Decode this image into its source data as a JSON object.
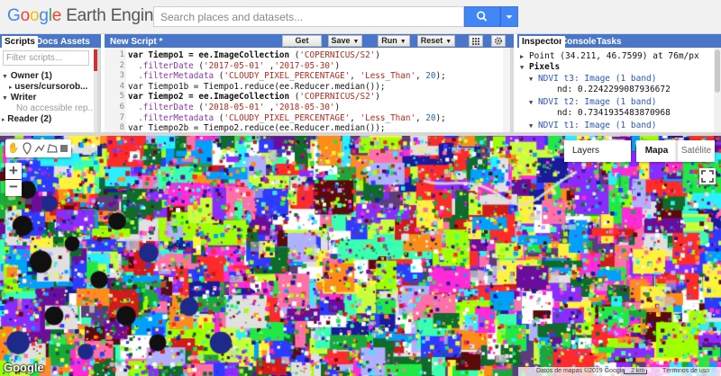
{
  "app": {
    "logo_google": "Google",
    "logo_rest": " Earth Engine"
  },
  "search": {
    "placeholder": "Search places and datasets..."
  },
  "left_tabs": [
    "Scripts",
    "Docs",
    "Assets"
  ],
  "scripts": {
    "filter_placeholder": "Filter scripts...",
    "tree": [
      {
        "label": "Owner",
        "count": "(1)"
      },
      {
        "label": "users/cursorob..."
      },
      {
        "label": "Writer"
      },
      {
        "label": "No accessible rep..."
      },
      {
        "label": "Reader",
        "count": "(2)"
      }
    ]
  },
  "editor": {
    "tab_title": "New Script *",
    "buttons": {
      "get_link": "Get Link",
      "save": "Save",
      "run": "Run",
      "reset": "Reset"
    },
    "line_numbers": [
      "1",
      "2",
      "3",
      "4",
      "5",
      "6",
      "7",
      "8"
    ],
    "lines": [
      [
        {
          "t": "var Tiempo1 = ",
          "c": "k"
        },
        {
          "t": "ee.ImageCollection",
          "c": "k"
        },
        {
          "t": " (",
          "c": ""
        },
        {
          "t": "'COPERNICUS/S2'",
          "c": "s"
        },
        {
          "t": ")",
          "c": ""
        }
      ],
      [
        {
          "t": "  .filterDate",
          "c": "m"
        },
        {
          "t": " (",
          "c": ""
        },
        {
          "t": "'2017-05-01'",
          "c": "s"
        },
        {
          "t": " ,",
          "c": ""
        },
        {
          "t": "'2017-05-30'",
          "c": "s"
        },
        {
          "t": ")",
          "c": ""
        }
      ],
      [
        {
          "t": "  .filterMetadata",
          "c": "m"
        },
        {
          "t": " (",
          "c": ""
        },
        {
          "t": "'CLOUDY_PIXEL_PERCENTAGE'",
          "c": "s"
        },
        {
          "t": ", ",
          "c": ""
        },
        {
          "t": "'Less_Than'",
          "c": "s"
        },
        {
          "t": ", ",
          "c": ""
        },
        {
          "t": "20",
          "c": "n"
        },
        {
          "t": ");",
          "c": ""
        }
      ],
      [
        {
          "t": "var Tiempo1b = Tiempo1.reduce(ee.Reducer.median());",
          "c": ""
        }
      ],
      [
        {
          "t": "var Tiempo2 = ",
          "c": "k"
        },
        {
          "t": "ee.ImageCollection",
          "c": "k"
        },
        {
          "t": " (",
          "c": ""
        },
        {
          "t": "'COPERNICUS/S2'",
          "c": "s"
        },
        {
          "t": ")",
          "c": ""
        }
      ],
      [
        {
          "t": "  .filterDate",
          "c": "m"
        },
        {
          "t": " (",
          "c": ""
        },
        {
          "t": "'2018-05-01'",
          "c": "s"
        },
        {
          "t": " ,",
          "c": ""
        },
        {
          "t": "'2018-05-30'",
          "c": "s"
        },
        {
          "t": ")",
          "c": ""
        }
      ],
      [
        {
          "t": "  .filterMetadata",
          "c": "m"
        },
        {
          "t": " (",
          "c": ""
        },
        {
          "t": "'CLOUDY_PIXEL_PERCENTAGE'",
          "c": "s"
        },
        {
          "t": ", ",
          "c": ""
        },
        {
          "t": "'Less_Than'",
          "c": "s"
        },
        {
          "t": ", ",
          "c": ""
        },
        {
          "t": "20",
          "c": "n"
        },
        {
          "t": ");",
          "c": ""
        }
      ],
      [
        {
          "t": "var Tiempo2b = Tiempo2.reduce(ee.Reducer.median());",
          "c": ""
        }
      ]
    ]
  },
  "right_tabs": [
    "Inspector",
    "Console",
    "Tasks"
  ],
  "inspector": {
    "point": "Point (34.211, 46.7599) at 76m/px",
    "pixels": "Pixels",
    "entries": [
      {
        "title": "NDVI t3: Image (1 band)",
        "value": "nd: 0.2242299087936672"
      },
      {
        "title": "NDVI t2: Image (1 band)",
        "value": "nd: 0.7341935483870968"
      },
      {
        "title": "NDVI t1: Image (1 band)"
      }
    ]
  },
  "map": {
    "layers_label": "Layers",
    "map_type_label": "Mapa",
    "satellite_label": "Satélite",
    "google_mark": "Google",
    "attribution": "Datos de mapas ©2019 Google",
    "scale_label": "2 km",
    "terms": "Términos de uso"
  },
  "colors": {
    "accent_blue": "#4285f4",
    "tab_bar": "#4a76c9"
  }
}
